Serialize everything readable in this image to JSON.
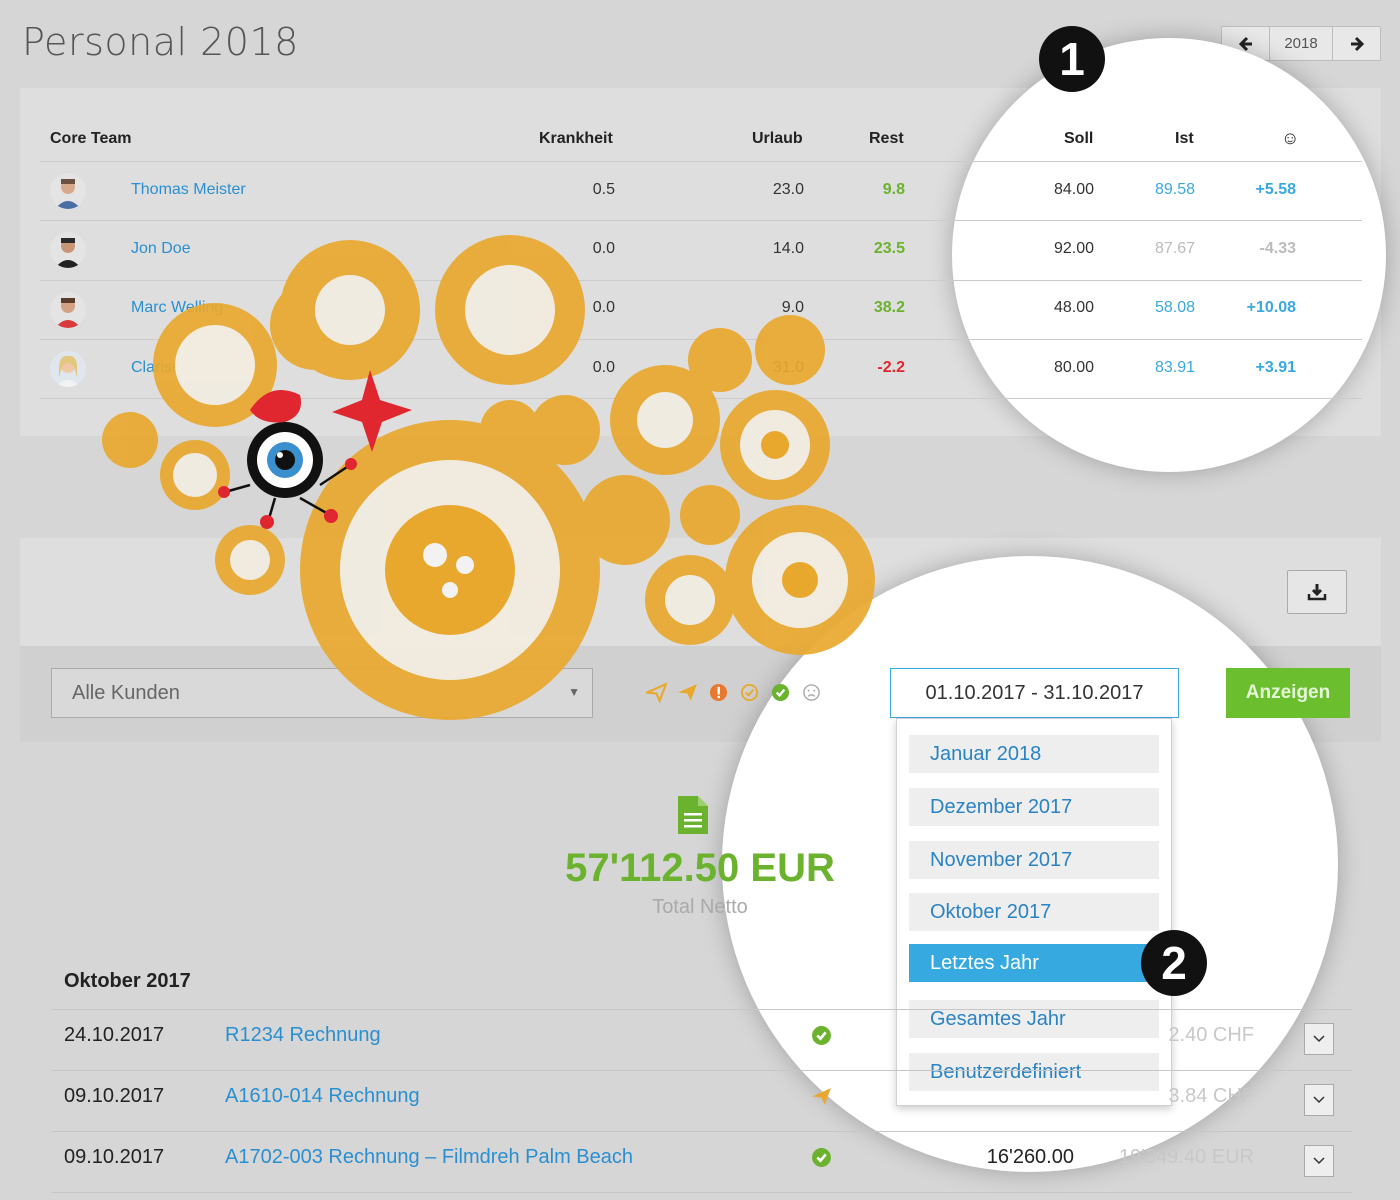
{
  "page": {
    "title": "Personal 2018"
  },
  "year_nav": {
    "year": "2018",
    "prev_icon": "arrow-left-icon",
    "next_icon": "arrow-right-icon"
  },
  "team_table": {
    "headers": {
      "team": "Core Team",
      "illness": "Krankheit",
      "vacation": "Urlaub",
      "rest": "Rest",
      "target": "Soll",
      "actual": "Ist",
      "mood": "☺"
    },
    "rows": [
      {
        "name": "Thomas Meister",
        "illness": "0.5",
        "vacation": "23.0",
        "rest": "9.8",
        "target": "84.00",
        "actual": "89.58",
        "diff": "+5.58"
      },
      {
        "name": "Jon Doe",
        "illness": "0.0",
        "vacation": "14.0",
        "rest": "23.5",
        "target": "92.00",
        "actual": "87.67",
        "diff": "-4.33"
      },
      {
        "name": "Marc Welling",
        "illness": "0.0",
        "vacation": "9.0",
        "rest": "38.2",
        "target": "48.00",
        "actual": "58.08",
        "diff": "+10.08"
      },
      {
        "name": "Clarissa Cler",
        "illness": "0.0",
        "vacation": "31.0",
        "rest": "-2.2",
        "target": "80.00",
        "actual": "83.91",
        "diff": "+3.91"
      }
    ]
  },
  "badges": {
    "one": "1",
    "two": "2"
  },
  "filters": {
    "customer_select": "Alle Kunden",
    "date_range": "01.10.2017 - 31.10.2017",
    "show_button": "Anzeigen",
    "download_icon": "download-icon",
    "status_icons": [
      "paper-plane-outline-icon",
      "paper-plane-icon",
      "exclamation-circle-icon",
      "check-circle-outline-icon",
      "check-circle-icon",
      "frown-icon"
    ]
  },
  "date_dropdown": {
    "options": [
      "Januar 2018",
      "Dezember 2017",
      "November 2017",
      "Oktober 2017",
      "Letztes Jahr",
      "Gesamtes Jahr",
      "Benutzerdefiniert"
    ],
    "highlighted": "Letztes Jahr"
  },
  "summary": {
    "amount": "57'112.50 EUR",
    "label": "Total Netto"
  },
  "invoices": {
    "month": "Oktober 2017",
    "rows": [
      {
        "date": "24.10.2017",
        "title": "R1234 Rechnung",
        "status": "check-circle-icon",
        "net": "",
        "gross": "2.40 CHF"
      },
      {
        "date": "09.10.2017",
        "title": "A1610-014 Rechnung",
        "status": "paper-plane-icon",
        "net": "",
        "gross": "3.84 CHF"
      },
      {
        "date": "09.10.2017",
        "title": "A1702-003 Rechnung – Filmdreh Palm Beach",
        "status": "check-circle-icon",
        "net": "16'260.00",
        "gross": "19'349.40 EUR"
      }
    ]
  },
  "colors": {
    "accent_blue": "#2a8fd0",
    "positive_green": "#6bb22e",
    "negative_red": "#e0262e",
    "gear_orange": "#e8a82e",
    "button_green": "#6bbf2f",
    "highlight_blue": "#36a9e1"
  }
}
